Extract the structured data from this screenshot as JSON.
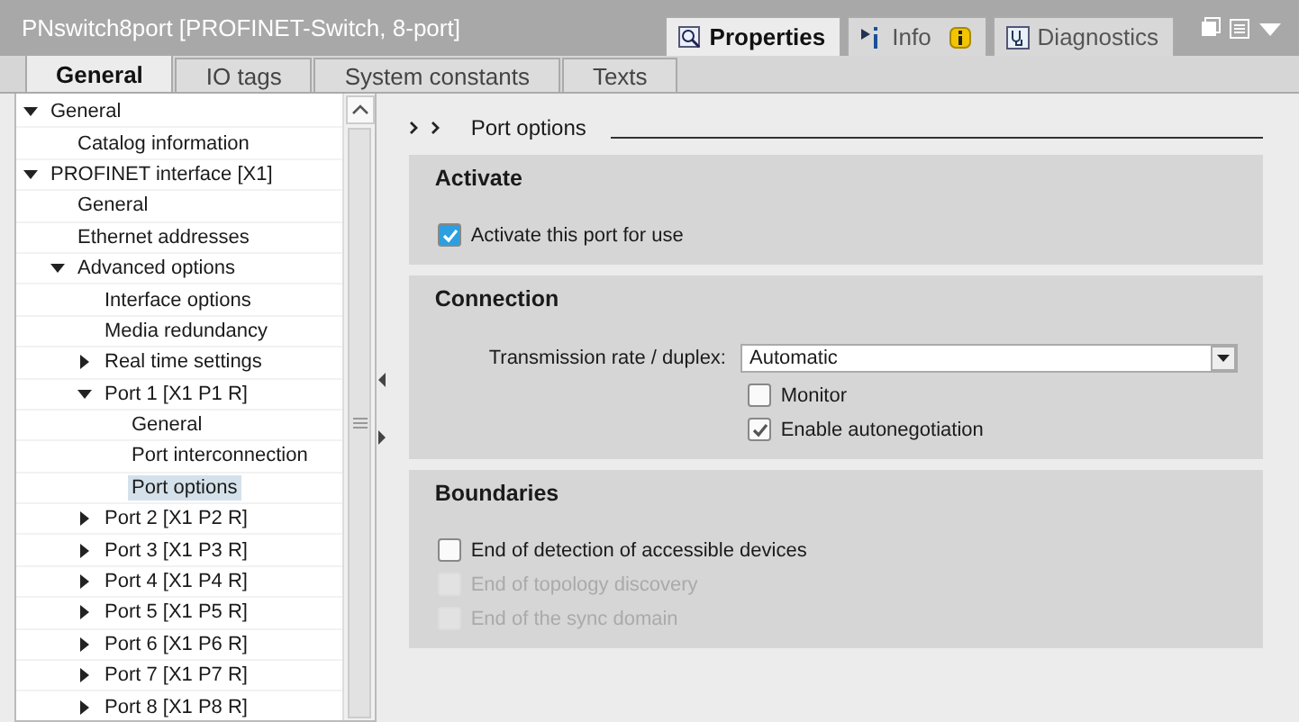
{
  "window": {
    "title": "PNswitch8port [PROFINET-Switch, 8-port]"
  },
  "view_tabs": [
    {
      "label": "Properties",
      "selected": true,
      "kind": "properties"
    },
    {
      "label": "Info",
      "selected": false,
      "kind": "info",
      "warning": true
    },
    {
      "label": "Diagnostics",
      "selected": false,
      "kind": "diagnostics"
    }
  ],
  "tabs": [
    {
      "label": "General",
      "selected": true
    },
    {
      "label": "IO tags",
      "selected": false
    },
    {
      "label": "System constants",
      "selected": false
    },
    {
      "label": "Texts",
      "selected": false
    }
  ],
  "tree": [
    {
      "label": "General",
      "expanded": true,
      "selected": false,
      "children": [
        {
          "label": "Catalog information",
          "selected": false
        }
      ]
    },
    {
      "label": "PROFINET interface [X1]",
      "expanded": true,
      "selected": false,
      "children": [
        {
          "label": "General",
          "selected": false
        },
        {
          "label": "Ethernet addresses",
          "selected": false
        },
        {
          "label": "Advanced options",
          "expanded": true,
          "selected": false,
          "children": [
            {
              "label": "Interface options",
              "selected": false
            },
            {
              "label": "Media redundancy",
              "selected": false
            },
            {
              "label": "Real time settings",
              "expanded": false,
              "selected": false
            },
            {
              "label": "Port 1 [X1 P1 R]",
              "expanded": true,
              "selected": false,
              "children": [
                {
                  "label": "General",
                  "selected": false
                },
                {
                  "label": "Port interconnection",
                  "selected": false
                },
                {
                  "label": "Port options",
                  "selected": true
                }
              ]
            },
            {
              "label": "Port 2 [X1 P2 R]",
              "expanded": false,
              "selected": false
            },
            {
              "label": "Port 3 [X1 P3 R]",
              "expanded": false,
              "selected": false
            },
            {
              "label": "Port 4 [X1 P4 R]",
              "expanded": false,
              "selected": false
            },
            {
              "label": "Port 5 [X1 P5 R]",
              "expanded": false,
              "selected": false
            },
            {
              "label": "Port 6 [X1 P6 R]",
              "expanded": false,
              "selected": false
            },
            {
              "label": "Port 7 [X1 P7 R]",
              "expanded": false,
              "selected": false
            },
            {
              "label": "Port 8 [X1 P8 R]",
              "expanded": false,
              "selected": false
            }
          ]
        }
      ]
    }
  ],
  "breadcrumb": {
    "title": "Port options"
  },
  "sections": [
    {
      "title": "Activate",
      "items": [
        {
          "kind": "checkbox",
          "label": "Activate this port for use",
          "checked": true,
          "disabled": false,
          "highlight": true
        }
      ]
    },
    {
      "title": "Connection",
      "items": [
        {
          "kind": "select",
          "label": "Transmission rate / duplex:",
          "value": "Automatic"
        },
        {
          "kind": "checkbox",
          "label": "Monitor",
          "checked": false,
          "disabled": false,
          "indented": true
        },
        {
          "kind": "checkbox",
          "label": "Enable autonegotiation",
          "checked": true,
          "disabled": false,
          "indented": true
        }
      ]
    },
    {
      "title": "Boundaries",
      "items": [
        {
          "kind": "checkbox",
          "label": "End of detection of accessible devices",
          "checked": false,
          "disabled": false
        },
        {
          "kind": "checkbox",
          "label": "End of topology discovery",
          "checked": false,
          "disabled": true
        },
        {
          "kind": "checkbox",
          "label": "End of the sync domain",
          "checked": false,
          "disabled": true
        }
      ]
    }
  ]
}
